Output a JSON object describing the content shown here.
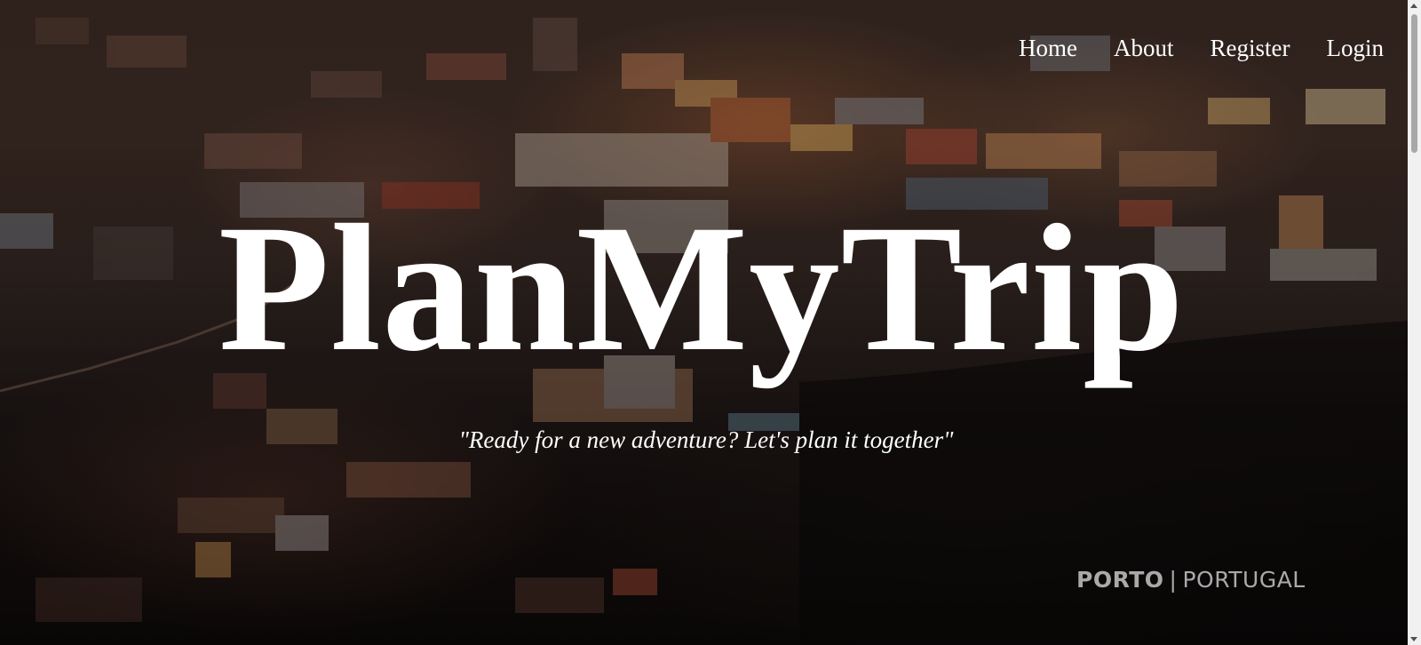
{
  "nav": {
    "items": [
      {
        "label": "Home"
      },
      {
        "label": "About"
      },
      {
        "label": "Register"
      },
      {
        "label": "Login"
      }
    ]
  },
  "hero": {
    "title": "PlanMyTrip",
    "tagline": "\"Ready for a new adventure? Let's plan it together\"",
    "background": "aerial-city-photo",
    "location": {
      "city": "PORTO",
      "separator": "|",
      "country": "PORTUGAL"
    }
  },
  "colors": {
    "text": "#ffffff",
    "watermark": "#d7d7d7",
    "scrollbar_track": "#f1f1f1",
    "scrollbar_thumb": "#a8a8a8"
  }
}
